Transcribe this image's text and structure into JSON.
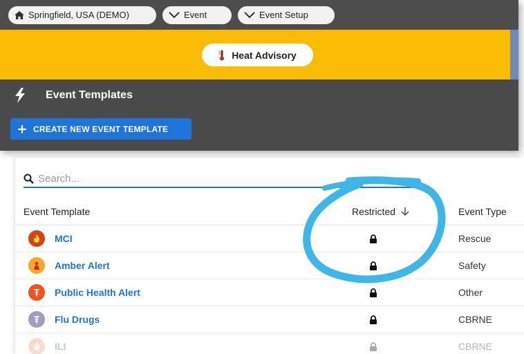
{
  "breadcrumbs": [
    {
      "label": "Springfield, USA (DEMO)",
      "icon": "home-icon"
    },
    {
      "label": "Event",
      "icon": "chevron-down-icon"
    },
    {
      "label": "Event Setup",
      "icon": "chevron-down-icon"
    }
  ],
  "advisory": {
    "label": "Heat Advisory",
    "icon": "thermometer-icon",
    "color": "#fbbc05"
  },
  "header": {
    "title": "Event Templates",
    "icon": "lightning-icon"
  },
  "create_button": {
    "label": "CREATE NEW EVENT TEMPLATE",
    "color": "#1e74d8"
  },
  "search": {
    "placeholder": "Search..."
  },
  "table": {
    "columns": {
      "name": "Event Template",
      "restricted": "Restricted",
      "type": "Event Type"
    },
    "sort": "restricted-descending",
    "rows": [
      {
        "name": "MCI",
        "restricted": true,
        "type": "Rescue",
        "avatar_color": "#d84315"
      },
      {
        "name": "Amber Alert",
        "restricted": true,
        "type": "Safety",
        "avatar_color": "#f9a825"
      },
      {
        "name": "Public Health Alert",
        "restricted": true,
        "type": "Other",
        "avatar_color": "#f4511e"
      },
      {
        "name": "Flu Drugs",
        "restricted": true,
        "type": "CBRNE",
        "avatar_color": "#9e9ec2"
      },
      {
        "name": "ILI",
        "restricted": true,
        "type": "CBRNE",
        "avatar_color": "#ef9a7a"
      }
    ]
  },
  "annotation": {
    "shape": "circle-highlight",
    "color": "#3eb6e8"
  }
}
